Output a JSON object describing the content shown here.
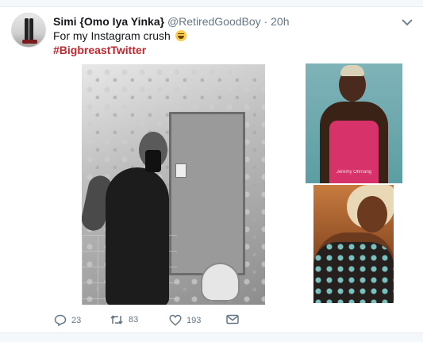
{
  "tweet": {
    "display_name": "Simi {Omo Iya Yinka}",
    "handle": "@RetiredGoodBoy",
    "separator": "·",
    "time": "20h",
    "text": "For my Instagram crush",
    "hashtag": "#BigbreastTwitter"
  },
  "media": {
    "top_right_watermark": "Jeremy Ohmang"
  },
  "actions": {
    "reply_count": "23",
    "retweet_count": "83",
    "like_count": "193"
  },
  "colors": {
    "hashtag": "#c0272d",
    "muted": "#657786",
    "text": "#14171a"
  },
  "icons": [
    "chevron-down-icon",
    "reply-icon",
    "retweet-icon",
    "like-icon",
    "message-icon",
    "grinning-emoji-icon"
  ]
}
